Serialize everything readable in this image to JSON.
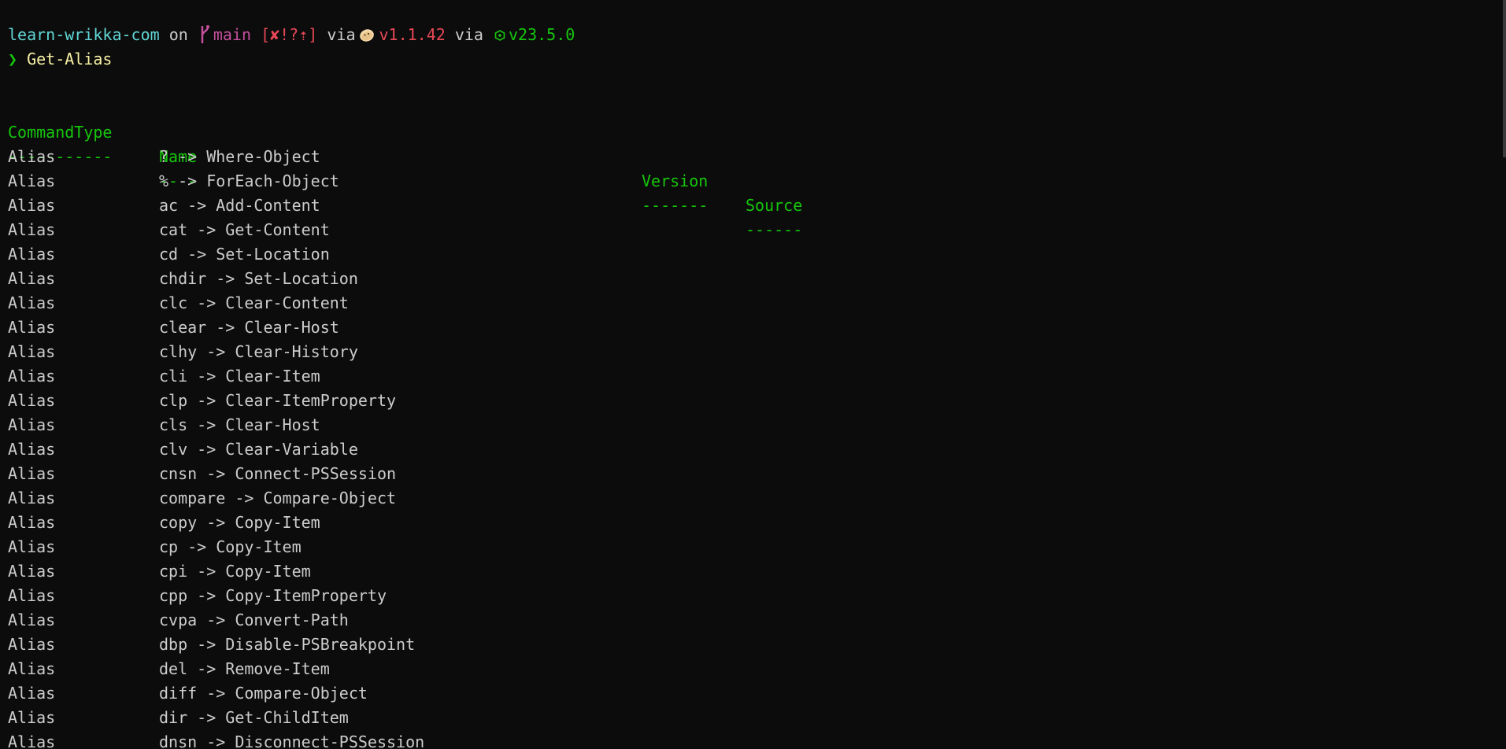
{
  "prompt": {
    "directory": "learn-wrikka-com",
    "on": "on",
    "branch": "main",
    "git_status": "[✘!?⇡]",
    "via1": "via",
    "tool_version": "v1.1.42",
    "via2": "via",
    "node_version": "v23.5.0",
    "symbol": "❯",
    "command": "Get-Alias"
  },
  "table": {
    "headers": [
      "CommandType",
      "Name",
      "Version",
      "Source"
    ],
    "underlines": [
      "-----------",
      "----",
      "-------",
      "------"
    ],
    "rows": [
      [
        "Alias",
        "? -> Where-Object"
      ],
      [
        "Alias",
        "% -> ForEach-Object"
      ],
      [
        "Alias",
        "ac -> Add-Content"
      ],
      [
        "Alias",
        "cat -> Get-Content"
      ],
      [
        "Alias",
        "cd -> Set-Location"
      ],
      [
        "Alias",
        "chdir -> Set-Location"
      ],
      [
        "Alias",
        "clc -> Clear-Content"
      ],
      [
        "Alias",
        "clear -> Clear-Host"
      ],
      [
        "Alias",
        "clhy -> Clear-History"
      ],
      [
        "Alias",
        "cli -> Clear-Item"
      ],
      [
        "Alias",
        "clp -> Clear-ItemProperty"
      ],
      [
        "Alias",
        "cls -> Clear-Host"
      ],
      [
        "Alias",
        "clv -> Clear-Variable"
      ],
      [
        "Alias",
        "cnsn -> Connect-PSSession"
      ],
      [
        "Alias",
        "compare -> Compare-Object"
      ],
      [
        "Alias",
        "copy -> Copy-Item"
      ],
      [
        "Alias",
        "cp -> Copy-Item"
      ],
      [
        "Alias",
        "cpi -> Copy-Item"
      ],
      [
        "Alias",
        "cpp -> Copy-ItemProperty"
      ],
      [
        "Alias",
        "cvpa -> Convert-Path"
      ],
      [
        "Alias",
        "dbp -> Disable-PSBreakpoint"
      ],
      [
        "Alias",
        "del -> Remove-Item"
      ],
      [
        "Alias",
        "diff -> Compare-Object"
      ],
      [
        "Alias",
        "dir -> Get-ChildItem"
      ],
      [
        "Alias",
        "dnsn -> Disconnect-PSSession"
      ]
    ]
  },
  "colors": {
    "background": "#0c0c0c",
    "foreground": "#cccccc",
    "cyan": "#61d6d6",
    "purple": "#c4509d",
    "red": "#e74856",
    "green": "#16c60c",
    "yellow": "#f9f1a5"
  },
  "icons": {
    "branch": "git-branch-icon",
    "tool": "bun-icon",
    "node": "nodejs-icon"
  }
}
